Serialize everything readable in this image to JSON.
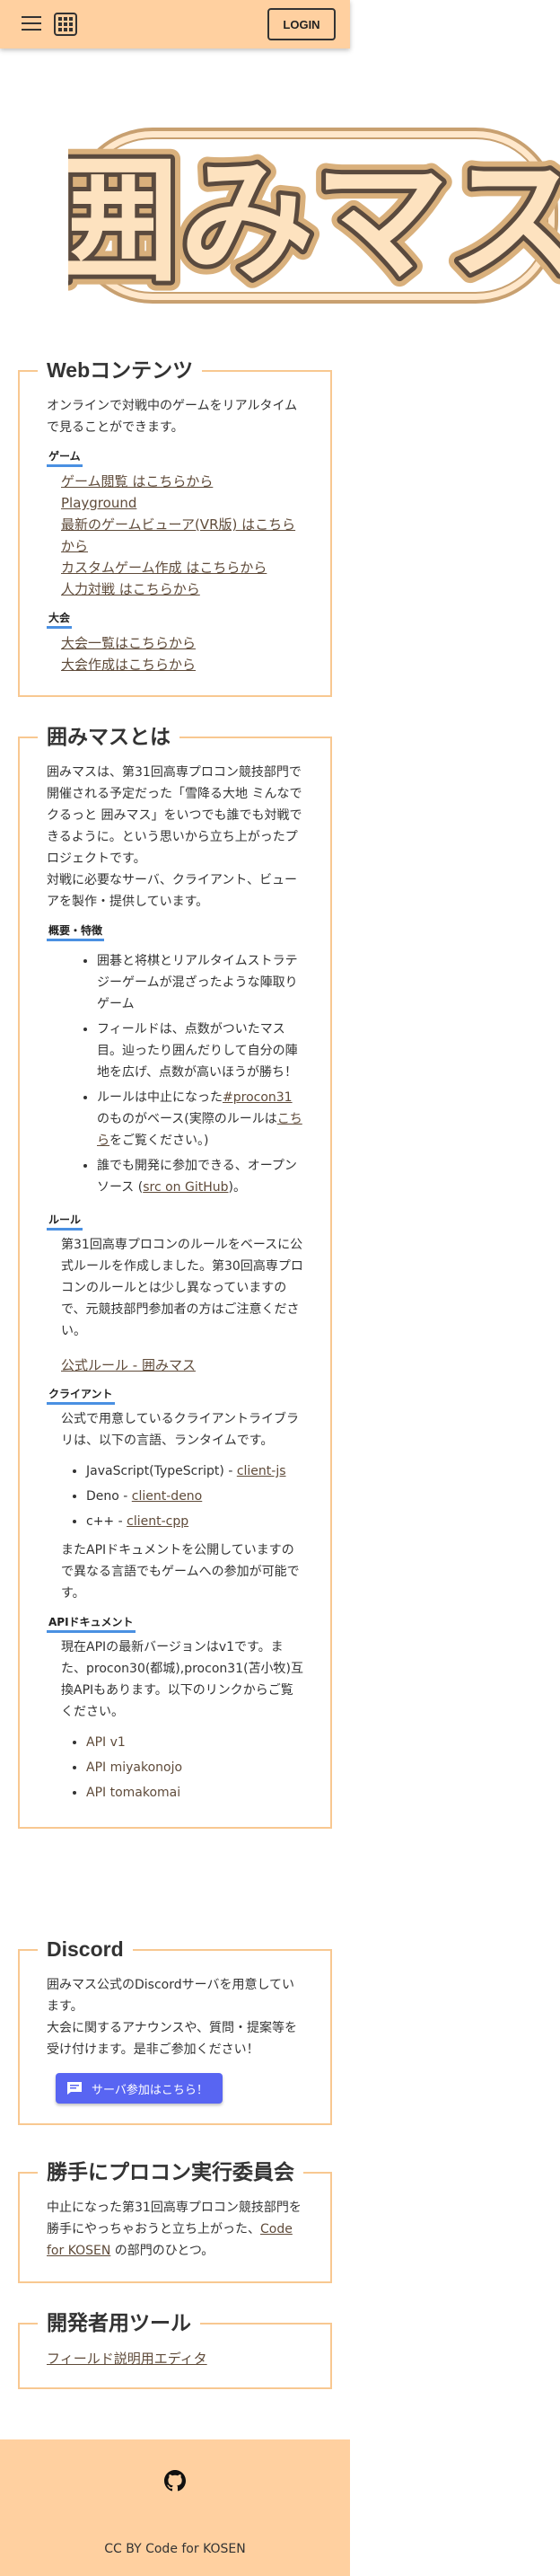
{
  "header": {
    "menu_icon": "hamburger-menu-icon",
    "apps_icon": "apps-grid-icon",
    "login_label": "LOGIN"
  },
  "logo": {
    "text": "囲みマス"
  },
  "web": {
    "title": "Webコンテンツ",
    "description": "オンラインで対戦中のゲームをリアルタイムで見ることができます。",
    "game_label": "ゲーム",
    "game_links": [
      "ゲーム閲覧 はこちらから",
      "Playground",
      "最新のゲームビューア(VR版) はこちらから",
      "カスタムゲーム作成 はこちらから",
      "人力対戦 はこちらから"
    ],
    "tournament_label": "大会",
    "tournament_links": [
      "大会一覧はこちらから",
      "大会作成はこちらから"
    ]
  },
  "about": {
    "title": "囲みマスとは",
    "intro1": "囲みマスは、第31回高専プロコン競技部門で開催される予定だった「雪降る大地 ミんなで クるっと 囲みマス」をいつでも誰でも対戦できるように。という思いから立ち上がったプロジェクトです。",
    "intro2": "対戦に必要なサーバ、クライアント、ビューアを製作・提供しています。",
    "overview_label": "概要・特徴",
    "features": {
      "f1": "囲碁と将棋とリアルタイムストラテジーゲームが混ざったような陣取りゲーム",
      "f2": "フィールドは、点数がついたマス目。辿ったり囲んだりして自分の陣地を広げ、点数が高いほうが勝ち！",
      "f3_pre": "ルールは中止になった",
      "f3_link": "#procon31",
      "f3_mid": "のものがベース(実際のルールは",
      "f3_link2": "こちら",
      "f3_post": "をご覧ください。)",
      "f4_pre": "誰でも開発に参加できる、オープンソース (",
      "f4_link": "src on GitHub",
      "f4_post": ")。"
    },
    "rules_label": "ルール",
    "rules_text": "第31回高専プロコンのルールをベースに公式ルールを作成しました。第30回高専プロコンのルールとは少し異なっていますので、元競技部門参加者の方はご注意ください。",
    "rules_link": "公式ルール - 囲みマス",
    "client_label": "クライアント",
    "client_text": "公式で用意しているクライアントライブラリは、以下の言語、ランタイムです。",
    "clients": {
      "c1_pre": "JavaScript(TypeScript) - ",
      "c1_link": "client-js",
      "c2_pre": "Deno - ",
      "c2_link": "client-deno",
      "c3_pre": "c++ - ",
      "c3_link": "client-cpp"
    },
    "client_note": "またAPIドキュメントを公開していますので異なる言語でもゲームへの参加が可能です。",
    "api_label": "APIドキュメント",
    "api_text": "現在APIの最新バージョンはv1です。また、procon30(都城),procon31(苫小牧)互換APIもあります。以下のリンクからご覧ください。",
    "api_links": [
      "API v1",
      "API miyakonojo",
      "API tomakomai"
    ]
  },
  "discord": {
    "title": "Discord",
    "text1": "囲みマス公式のDiscordサーバを用意しています。",
    "text2": "大会に関するアナウンスや、質問・提案等を受け付けます。是非ご参加ください！",
    "button_label": "サーバ参加はこちら！",
    "button_color": "#5865f2"
  },
  "committee": {
    "title": "勝手にプロコン実行委員会",
    "text_pre": "中止になった第31回高専プロコン競技部門を勝手にやっちゃおうと立ち上がった、",
    "link": "Code for KOSEN",
    "text_post": " の部門のひとつ。"
  },
  "devtools": {
    "title": "開発者用ツール",
    "link": "フィールド説明用エディタ"
  },
  "footer": {
    "github_icon": "github-icon",
    "text": "CC BY Code for KOSEN"
  },
  "colors": {
    "header_bg": "#ffd0a0",
    "section_border": "#f8c891",
    "subheading_underline": "#4a90e2",
    "link": "#5f4b3a"
  }
}
